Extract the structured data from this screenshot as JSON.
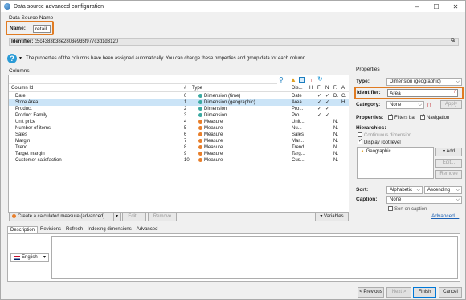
{
  "window": {
    "title": "Data source advanced configuration"
  },
  "datasource": {
    "group_label": "Data Source Name",
    "name_label": "Name:",
    "name_value": "retail",
    "identifier_label": "Identifier:",
    "identifier_value": "c5c4383b38e2803e935f977c3d1d3120"
  },
  "info": {
    "text": "The properties of the columns have been assigned automatically. You can change these properties and group data for each column."
  },
  "columns": {
    "title": "Columns",
    "headers": {
      "column_id": "Column Id",
      "num": "#",
      "type": "Type",
      "display": "Dis...",
      "h": "H",
      "f": "F",
      "n": "N",
      "fmt": "F.",
      "a": "A"
    },
    "rows": [
      {
        "id": "Date",
        "num": "0",
        "type": "Dimension (time)",
        "dot": "#3aa9a1",
        "display": "Date",
        "f": "✓",
        "n": "✓",
        "fmt": "D.",
        "a": "C."
      },
      {
        "id": "Store Area",
        "num": "1",
        "type": "Dimension (geographic)",
        "dot": "#3aa9a1",
        "display": "Area",
        "f": "✓",
        "n": "✓",
        "fmt": "",
        "a": "H."
      },
      {
        "id": "Product",
        "num": "2",
        "type": "Dimension",
        "dot": "#3aa9a1",
        "display": "Pro...",
        "f": "✓",
        "n": "✓",
        "fmt": "",
        "a": ""
      },
      {
        "id": "Product Family",
        "num": "3",
        "type": "Dimension",
        "dot": "#3aa9a1",
        "display": "Pro...",
        "f": "✓",
        "n": "✓",
        "fmt": "",
        "a": ""
      },
      {
        "id": "Unit price",
        "num": "4",
        "type": "Measure",
        "dot": "#e87e2a",
        "display": "Unit...",
        "f": "",
        "n": "",
        "fmt": "N.",
        "a": ""
      },
      {
        "id": "Number of items",
        "num": "5",
        "type": "Measure",
        "dot": "#e87e2a",
        "display": "Nu...",
        "f": "",
        "n": "",
        "fmt": "N.",
        "a": ""
      },
      {
        "id": "Sales",
        "num": "6",
        "type": "Measure",
        "dot": "#e87e2a",
        "display": "Sales",
        "f": "",
        "n": "",
        "fmt": "N.",
        "a": ""
      },
      {
        "id": "Margin",
        "num": "7",
        "type": "Measure",
        "dot": "#e87e2a",
        "display": "Mar...",
        "f": "",
        "n": "",
        "fmt": "N.",
        "a": ""
      },
      {
        "id": "Trend",
        "num": "8",
        "type": "Measure",
        "dot": "#e87e2a",
        "display": "Trend",
        "f": "",
        "n": "",
        "fmt": "N.",
        "a": ""
      },
      {
        "id": "Target margin",
        "num": "9",
        "type": "Measure",
        "dot": "#e87e2a",
        "display": "Targ...",
        "f": "",
        "n": "",
        "fmt": "N.",
        "a": ""
      },
      {
        "id": "Customer satisfaction",
        "num": "10",
        "type": "Measure",
        "dot": "#e87e2a",
        "display": "Cus...",
        "f": "",
        "n": "",
        "fmt": "N.",
        "a": ""
      }
    ],
    "create_measure": "Create a calculated measure (advanced)...",
    "edit": "Edit...",
    "remove": "Remove",
    "variables": "Variables"
  },
  "properties": {
    "title": "Properties",
    "type_label": "Type:",
    "type_value": "Dimension (geographic)",
    "identifier_label": "Identifier:",
    "identifier_value": "Area",
    "category_label": "Category:",
    "category_value": "None",
    "apply": "Apply",
    "properties_label": "Properties:",
    "filters_bar": "Filters bar",
    "navigation": "Navigation",
    "hierarchies_label": "Hierarchies:",
    "continuous_dimension": "Continuous dimension",
    "display_root_level": "Display root level",
    "hierarchy_item": "Geographic",
    "add": "Add",
    "edit": "Edit...",
    "remove": "Remove",
    "sort_label": "Sort:",
    "sort_value": "Alphabetic",
    "sort_order": "Ascending",
    "caption_label": "Caption:",
    "caption_value": "None",
    "sort_on_caption": "Sort on caption",
    "advanced": "Advanced..."
  },
  "tabs": [
    "Description",
    "Revisions",
    "Refresh",
    "Indexing dimensions",
    "Advanced"
  ],
  "description": {
    "language": "English"
  },
  "footer": {
    "previous": "< Previous",
    "next": "Next >",
    "finish": "Finish",
    "cancel": "Cancel"
  },
  "colors": {
    "accent": "#e07b22",
    "selection": "#cbe4f7",
    "dimension": "#3aa9a1",
    "measure": "#e87e2a"
  }
}
